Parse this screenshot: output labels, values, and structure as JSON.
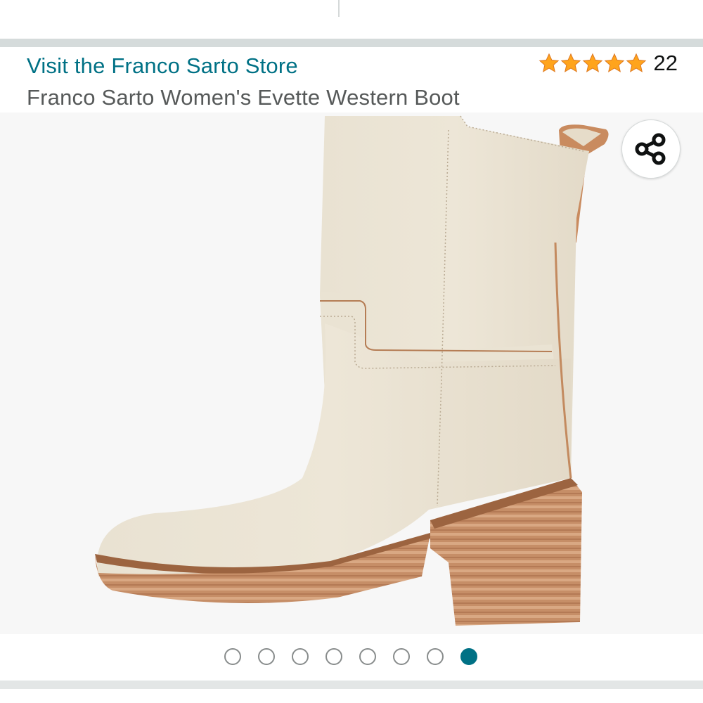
{
  "header": {
    "store_link": "Visit the Franco Sarto Store",
    "rating": {
      "stars": 5,
      "count": "22",
      "star_color": "#ffa41c"
    },
    "product_title": "Franco Sarto Women's Evette Western Boot"
  },
  "gallery": {
    "share_icon": "share-icon",
    "total_images": 8,
    "active_index": 7,
    "active_color": "#007185"
  },
  "colors": {
    "link": "#007185",
    "title": "#565959"
  }
}
